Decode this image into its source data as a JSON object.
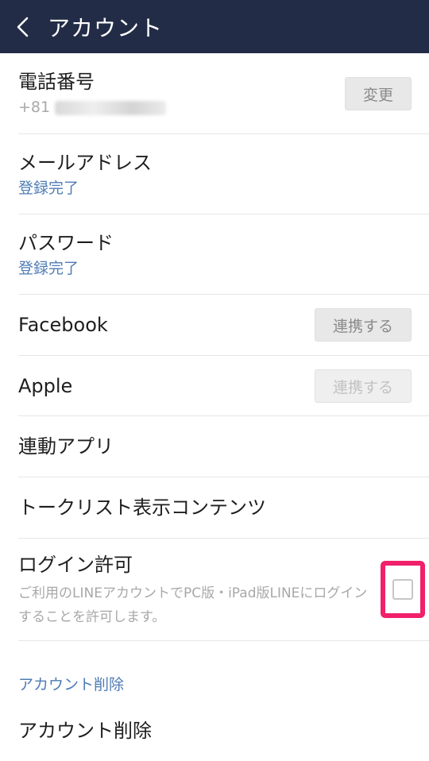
{
  "header": {
    "title": "アカウント",
    "back_icon": "chevron-left-icon"
  },
  "rows": {
    "phone": {
      "label": "電話番号",
      "value_prefix": "+81",
      "button": "変更"
    },
    "email": {
      "label": "メールアドレス",
      "status": "登録完了"
    },
    "password": {
      "label": "パスワード",
      "status": "登録完了"
    },
    "facebook": {
      "label": "Facebook",
      "button": "連携する"
    },
    "apple": {
      "label": "Apple",
      "button": "連携する"
    },
    "linked_apps": {
      "label": "連動アプリ"
    },
    "talk_list": {
      "label": "トークリスト表示コンテンツ"
    },
    "login_permission": {
      "label": "ログイン許可",
      "description": "ご利用のLINEアカウントでPC版・iPad版LINEにログインすることを許可します。",
      "checked": false
    }
  },
  "delete_section": {
    "header": "アカウント削除",
    "item": "アカウント削除"
  },
  "colors": {
    "header_bg": "#232c47",
    "accent_blue": "#4f7cb5",
    "highlight": "#f0206a"
  }
}
